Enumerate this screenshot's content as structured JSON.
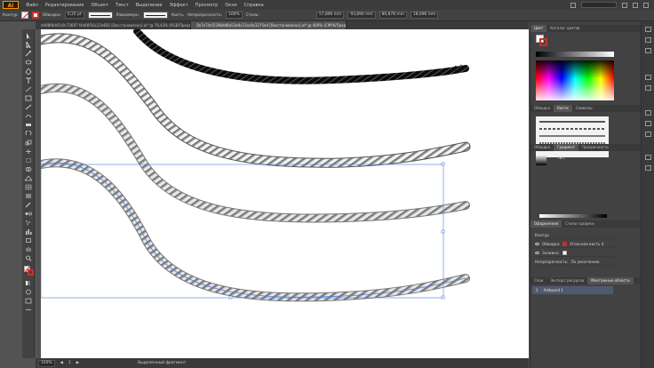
{
  "menu": {
    "logo": "Ai",
    "items": [
      "Файл",
      "Редактирование",
      "Объект",
      "Текст",
      "Выделение",
      "Эффект",
      "Просмотр",
      "Окно",
      "Справка"
    ]
  },
  "control": {
    "object_label": "Контур",
    "stroke_label": "Обводка:",
    "stroke_value": "0,25 pt",
    "profile_label": "Равномерн.",
    "brush_label": "Кисть",
    "opacity_label": "Непрозрачность:",
    "opacity_value": "100%",
    "style_label": "Стиль:",
    "x_value": "57,896 mm",
    "y_value": "93,890 mm",
    "w_value": "80,878 mm",
    "h_value": "18,696 mm"
  },
  "tabs": [
    {
      "label": "d498f8d45c0c73697 f4d66f56c23e681 [Восстановлено].ai* @ 76,43% (RGB/Предварительный просмотр)",
      "active": false
    },
    {
      "label": "5b7e74cf2298dd8a53a9c21ac8c3275e4 [Восстановлено].ai* @ 400% (CMYK/Предварительный просмотр)",
      "active": true
    }
  ],
  "status": {
    "zoom": "100%",
    "page": "1",
    "tool": "Выделенный фрагмент"
  },
  "panels": {
    "color_tabs": [
      "Цвет",
      "Каталог цветов"
    ],
    "brush_tabs": [
      "Обводка",
      "Кисти",
      "Символы"
    ],
    "gradient_tabs": [
      "Обводка",
      "Градиент",
      "Прозрачность"
    ],
    "gradient_type_label": "Тип:",
    "appearance_tabs": [
      "Оформление",
      "Стили графики"
    ],
    "appearance_rows": [
      {
        "label": "Контур"
      },
      {
        "label": "Обводка:",
        "value": "Угольная кисть 4"
      },
      {
        "label": "Заливка:"
      },
      {
        "label": "Непрозрачность:",
        "value": "По умолчанию"
      }
    ],
    "layer_tabs": [
      "Слои",
      "Экспорт ресурсов",
      "Монтажные области"
    ],
    "layer_row": {
      "index": "1",
      "name": "Artboard 1"
    }
  },
  "colors": {
    "accent_red": "#c9302c",
    "artboard": "#ffffff",
    "chrome": "#535353",
    "selection_blue": "#4f7fd9"
  }
}
